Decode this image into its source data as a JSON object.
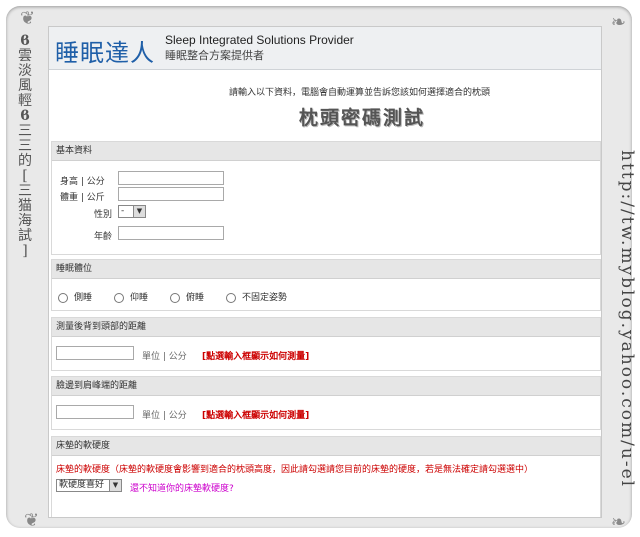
{
  "header": {
    "logo_cn": "睡眠達人",
    "logo_en": "Sleep Integrated Solutions Provider",
    "logo_sub": "睡眠整合方案提供者"
  },
  "intro": "請輸入以下資料，電腦會自動運算並告訴您該如何選擇適合的枕頭",
  "test_title": "枕頭密碼測試",
  "basic": {
    "heading": "基本資料",
    "height_label": "身高 | 公分",
    "weight_label": "體重 | 公斤",
    "gender_label": "性別",
    "gender_value": "-",
    "age_label": "年齡"
  },
  "posture": {
    "heading": "睡眠體位",
    "options": [
      "側睡",
      "仰睡",
      "俯睡",
      "不固定姿勢"
    ]
  },
  "back_head": {
    "heading": "測量後背到頭部的距離",
    "unit": "單位 | 公分",
    "link": "[點選輸入框顯示如何測量]"
  },
  "face_shoulder": {
    "heading": "臉邊到肩峰端的距離",
    "unit": "單位 | 公分",
    "link": "[點選輸入框顯示如何測量]"
  },
  "mattress": {
    "heading": "床墊的軟硬度",
    "desc": "床墊的軟硬度（床墊的軟硬度會影響到適合的枕頭高度，因此請勾選請您目前的床墊的硬度，若是無法確定請勾選選中）",
    "select_value": "軟硬度喜好",
    "link": "還不知道你的床墊軟硬度?"
  },
  "watermark": {
    "left_chars": [
      "雲",
      "淡",
      "風",
      "輕",
      "三",
      "三",
      "的",
      "[",
      "三",
      "猫",
      "海",
      "試",
      "]"
    ],
    "right_url": "http://tw.myblog.yahoo.com/u-el"
  }
}
